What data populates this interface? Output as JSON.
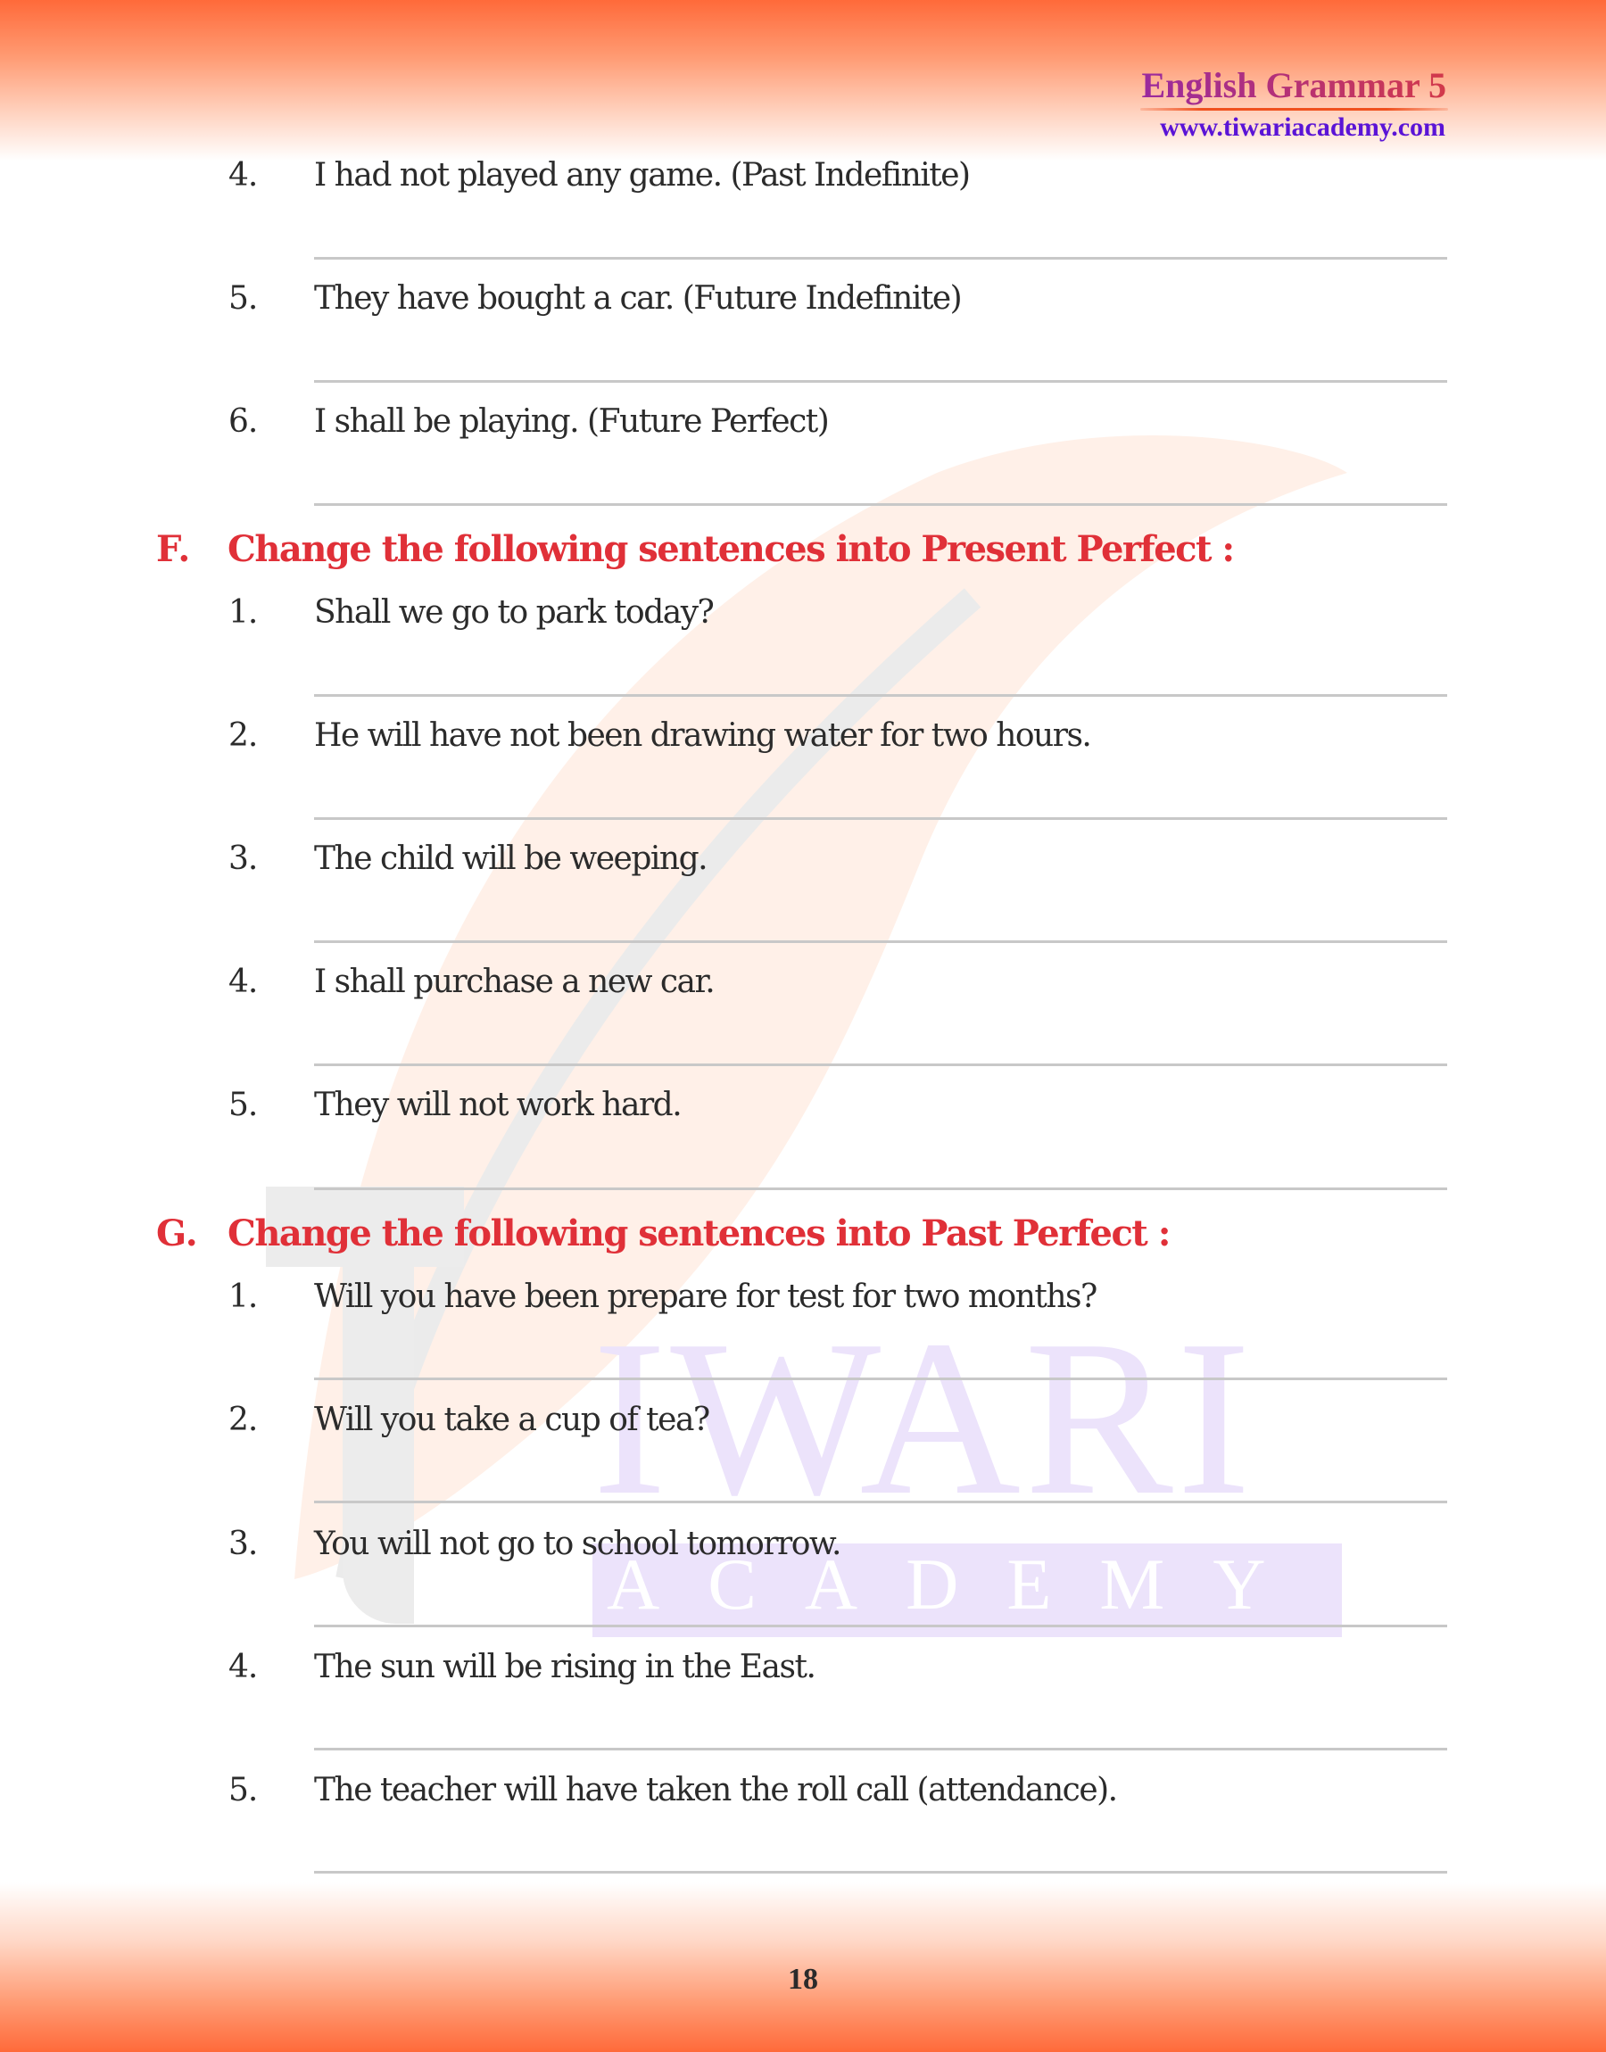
{
  "header": {
    "title": "English Grammar 5",
    "url": "www.tiwariacademy.com"
  },
  "watermark": {
    "word1": "IWARI",
    "word2": "ACADEMY"
  },
  "continued_items": [
    {
      "num": "4.",
      "text": "I had not played any game. (Past Indefinite)"
    },
    {
      "num": "5.",
      "text": "They have bought a car. (Future Indefinite)"
    },
    {
      "num": "6.",
      "text": "I shall be playing. (Future Perfect)"
    }
  ],
  "sections": [
    {
      "letter": "F.",
      "title": "Change the following sentences into Present Perfect :",
      "items": [
        {
          "num": "1.",
          "text": "Shall we go to park today?"
        },
        {
          "num": "2.",
          "text": "He will have not been drawing water for two hours."
        },
        {
          "num": "3.",
          "text": "The child will be weeping."
        },
        {
          "num": "4.",
          "text": "I shall purchase a new car."
        },
        {
          "num": "5.",
          "text": "They will not work hard."
        }
      ]
    },
    {
      "letter": "G.",
      "title": "Change the following sentences into Past Perfect :",
      "items": [
        {
          "num": "1.",
          "text": "Will you have been prepare for test for two months?"
        },
        {
          "num": "2.",
          "text": "Will you take a cup of tea?"
        },
        {
          "num": "3.",
          "text": "You will not go to school tomorrow."
        },
        {
          "num": "4.",
          "text": "The sun will be rising in the East."
        },
        {
          "num": "5.",
          "text": "The teacher will have taken the roll call (attendance)."
        }
      ]
    }
  ],
  "footer": {
    "page_number": "18"
  }
}
